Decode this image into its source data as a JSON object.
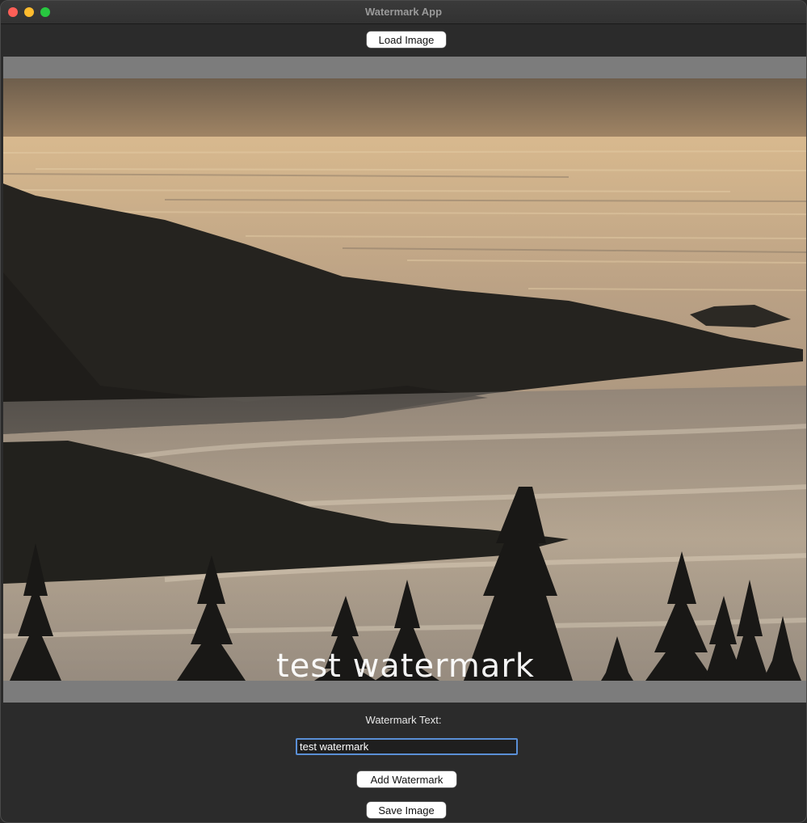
{
  "window": {
    "title": "Watermark App"
  },
  "toolbar": {
    "load_label": "Load Image"
  },
  "preview": {
    "watermark_text": "test watermark"
  },
  "controls": {
    "watermark_label": "Watermark Text:",
    "watermark_input_value": "test watermark",
    "add_label": "Add Watermark",
    "save_label": "Save Image"
  },
  "colors": {
    "window_bg": "#2b2b2b",
    "canvas_bg": "#7c7c7c",
    "input_focus": "#5a8fd6"
  }
}
